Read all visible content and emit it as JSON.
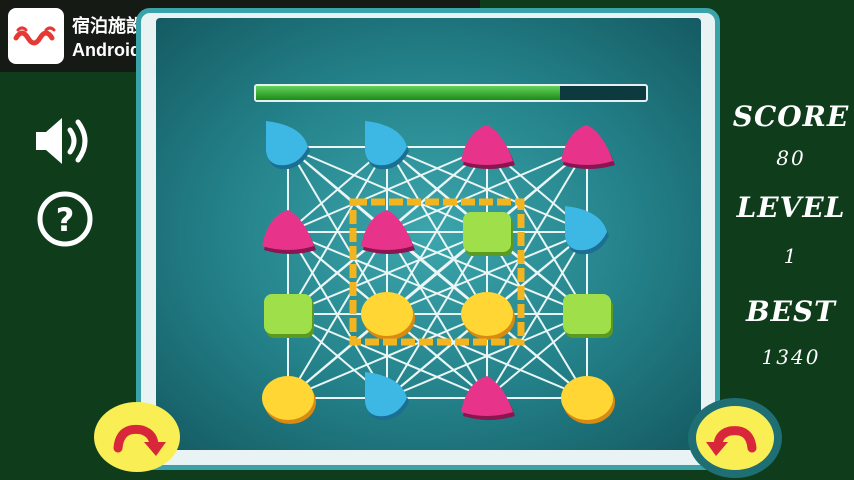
{
  "ad": {
    "line1": "宿泊施設の予約ができる！[じゃらん]",
    "line2": "Androidアプリ",
    "logo_icon": "jalan-logo-icon",
    "download_icon": "download-icon"
  },
  "stats": {
    "score_label": "SCORE",
    "score_value": "80",
    "level_label": "LEVEL",
    "level_value": "1",
    "best_label": "BEST",
    "best_value": "1340"
  },
  "controls": {
    "sound_icon": "speaker-icon",
    "help_icon": "question-icon",
    "rotate_left_icon": "rotate-left-arrow-icon",
    "rotate_right_icon": "rotate-right-arrow-icon"
  },
  "timer": {
    "fraction": 0.78
  },
  "colors": {
    "blue": "#3db7e4",
    "pink": "#e8338a",
    "green": "#9fe04a",
    "yellow": "#ffd633",
    "selection": "#f2b51f"
  },
  "grid": {
    "rows": 4,
    "cols": 4,
    "tiles": [
      [
        "blue",
        "blue",
        "pink",
        "pink"
      ],
      [
        "pink",
        "pink",
        "green",
        "blue"
      ],
      [
        "green",
        "yellow",
        "yellow",
        "green"
      ],
      [
        "yellow",
        "blue",
        "pink",
        "yellow"
      ]
    ],
    "selection": {
      "row": 1,
      "col": 1,
      "rows": 2,
      "cols": 2
    }
  }
}
